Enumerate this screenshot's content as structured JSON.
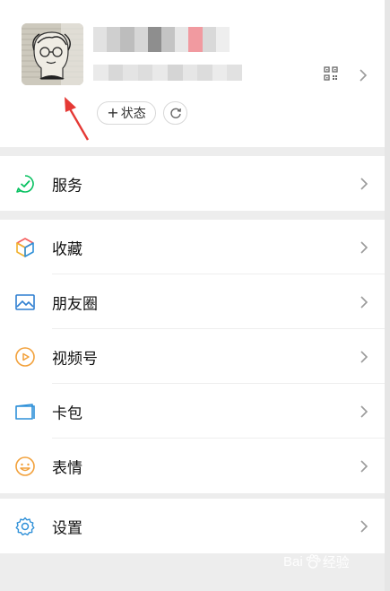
{
  "profile": {
    "status_plus": "+",
    "status_label": "状态",
    "name_blur_colors": [
      "#e2e2e2",
      "#cfcfcf",
      "#bdbdbd",
      "#d6d6d6",
      "#8e8e8e",
      "#c4c4c4",
      "#e7e7e7",
      "#f19aa0",
      "#d9d9d9",
      "#eeeeee"
    ],
    "id_blur_colors": [
      "#eaeaea",
      "#d8d8d8",
      "#e4e4e4",
      "#dddddd",
      "#e9e9e9",
      "#d5d5d5",
      "#e6e6e6",
      "#dcdcdc",
      "#ebebeb",
      "#e1e1e1"
    ]
  },
  "menu": {
    "service": {
      "label": "服务",
      "icon": "service-check-icon",
      "color": "#07c160"
    },
    "favorites": {
      "label": "收藏",
      "icon": "cube-icon"
    },
    "moments": {
      "label": "朋友圈",
      "icon": "image-icon",
      "color": "#2f7fd1"
    },
    "channels": {
      "label": "视频号",
      "icon": "play-circle-icon",
      "color": "#f2a13b"
    },
    "cards": {
      "label": "卡包",
      "icon": "wallet-icon",
      "color": "#2f90d8"
    },
    "stickers": {
      "label": "表情",
      "icon": "smile-icon",
      "color": "#f2a13b"
    },
    "settings": {
      "label": "设置",
      "icon": "gear-icon",
      "color": "#2f90d8"
    }
  },
  "annotation": {
    "arrow_color": "#e53935"
  },
  "watermark": {
    "left": "Bai",
    "right": "经验"
  }
}
